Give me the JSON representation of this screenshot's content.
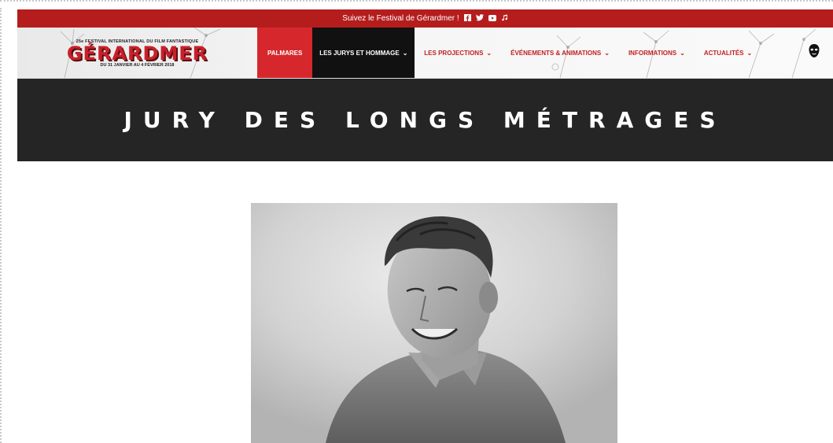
{
  "topbar": {
    "text": "Suivez le Festival de Gérardmer !",
    "icons": [
      "facebook-icon",
      "twitter-icon",
      "youtube-icon",
      "music-icon"
    ]
  },
  "logo": {
    "tagline": "25e FESTIVAL INTERNATIONAL DU FILM FANTASTIQUE",
    "title": "GÉRARDMER",
    "dates": "DU 31 JANVIER AU 4 FÉVRIER 2018"
  },
  "nav": {
    "items": [
      {
        "label": "PALMARES"
      },
      {
        "label": "LES JURYS ET HOMMAGE"
      },
      {
        "label": "LES PROJECTIONS"
      },
      {
        "label": "ÉVÉNEMENTS & ANIMATIONS"
      },
      {
        "label": "INFORMATIONS"
      },
      {
        "label": "ACTUALITÉS"
      }
    ]
  },
  "banner": {
    "title": "JURY DES LONGS MÉTRAGES"
  },
  "colors": {
    "brand_red": "#b51d1d",
    "active_red": "#d6282c",
    "banner_dark": "#252525"
  }
}
